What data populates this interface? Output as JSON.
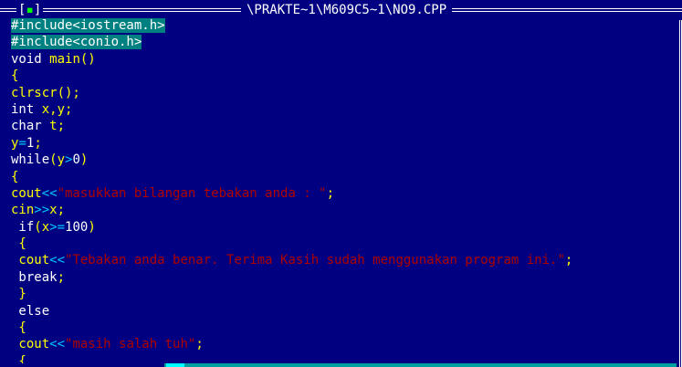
{
  "window": {
    "title": "\\PRAKTE~1\\M609C5~1\\NO9.CPP",
    "close_box_left": "[",
    "close_box_glyph": "▪",
    "close_box_right": "]"
  },
  "editor": {
    "lines": [
      [
        {
          "t": "#include<iostream.h>",
          "c": "pre"
        }
      ],
      [
        {
          "t": "#include<conio.h>",
          "c": "pre"
        }
      ],
      [
        {
          "t": "void ",
          "c": "kw"
        },
        {
          "t": "main",
          "c": "fn"
        },
        {
          "t": "()",
          "c": "punc"
        }
      ],
      [
        {
          "t": "{",
          "c": "punc"
        }
      ],
      [
        {
          "t": "clrscr",
          "c": "fn"
        },
        {
          "t": "();",
          "c": "punc"
        }
      ],
      [
        {
          "t": "int ",
          "c": "kw"
        },
        {
          "t": "x",
          "c": "ident"
        },
        {
          "t": ",",
          "c": "punc"
        },
        {
          "t": "y",
          "c": "ident"
        },
        {
          "t": ";",
          "c": "punc"
        }
      ],
      [
        {
          "t": "char ",
          "c": "kw"
        },
        {
          "t": "t",
          "c": "ident"
        },
        {
          "t": ";",
          "c": "punc"
        }
      ],
      [
        {
          "t": "y",
          "c": "ident"
        },
        {
          "t": "=",
          "c": "op"
        },
        {
          "t": "1",
          "c": "num"
        },
        {
          "t": ";",
          "c": "punc"
        }
      ],
      [
        {
          "t": "while",
          "c": "kw"
        },
        {
          "t": "(",
          "c": "punc"
        },
        {
          "t": "y",
          "c": "ident"
        },
        {
          "t": ">",
          "c": "op"
        },
        {
          "t": "0",
          "c": "num"
        },
        {
          "t": ")",
          "c": "punc"
        }
      ],
      [
        {
          "t": "{",
          "c": "punc"
        }
      ],
      [
        {
          "t": "cout",
          "c": "fn"
        },
        {
          "t": "<<",
          "c": "op"
        },
        {
          "t": "\"masukkan bilangan tebakan anda : \"",
          "c": "str"
        },
        {
          "t": ";",
          "c": "punc"
        }
      ],
      [
        {
          "t": "cin",
          "c": "fn"
        },
        {
          "t": ">>",
          "c": "op"
        },
        {
          "t": "x",
          "c": "ident"
        },
        {
          "t": ";",
          "c": "punc"
        }
      ],
      [
        {
          "t": " if",
          "c": "kw"
        },
        {
          "t": "(",
          "c": "punc"
        },
        {
          "t": "x",
          "c": "ident"
        },
        {
          "t": ">=",
          "c": "op"
        },
        {
          "t": "100",
          "c": "num"
        },
        {
          "t": ")",
          "c": "punc"
        }
      ],
      [
        {
          "t": " {",
          "c": "punc"
        }
      ],
      [
        {
          "t": " cout",
          "c": "fn"
        },
        {
          "t": "<<",
          "c": "op"
        },
        {
          "t": "\"Tebakan anda benar. Terima Kasih sudah menggunakan program ini.\"",
          "c": "str"
        },
        {
          "t": ";",
          "c": "punc"
        }
      ],
      [
        {
          "t": " break",
          "c": "kw"
        },
        {
          "t": ";",
          "c": "punc"
        }
      ],
      [
        {
          "t": " }",
          "c": "punc"
        }
      ],
      [
        {
          "t": " else",
          "c": "kw"
        }
      ],
      [
        {
          "t": " {",
          "c": "punc"
        }
      ],
      [
        {
          "t": " cout",
          "c": "fn"
        },
        {
          "t": "<<",
          "c": "op"
        },
        {
          "t": "\"masih salah tuh\"",
          "c": "str"
        },
        {
          "t": ";",
          "c": "punc"
        }
      ],
      [
        {
          "t": " {",
          "c": "punc"
        }
      ]
    ]
  },
  "colors": {
    "background": "#000080",
    "preprocessor_bg": "#008080",
    "keyword": "#ffffff",
    "identifier": "#ffff00",
    "operator": "#00c8ff",
    "string": "#b00000"
  }
}
